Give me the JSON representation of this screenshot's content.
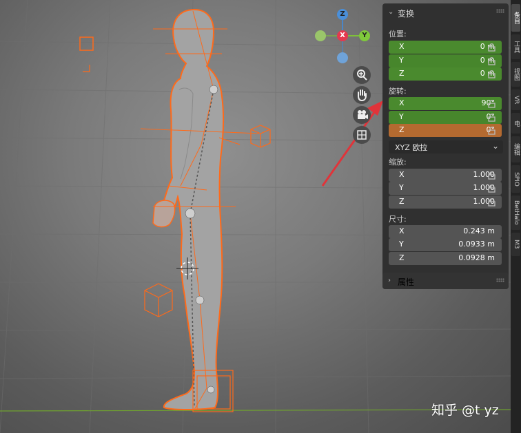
{
  "transform_panel": {
    "title": "变换",
    "location": {
      "label": "位置:",
      "rows": [
        {
          "axis": "X",
          "value": "0 m"
        },
        {
          "axis": "Y",
          "value": "0 m"
        },
        {
          "axis": "Z",
          "value": "0 m"
        }
      ]
    },
    "rotation": {
      "label": "旋转:",
      "rows": [
        {
          "axis": "X",
          "value": "90°"
        },
        {
          "axis": "Y",
          "value": "0°"
        },
        {
          "axis": "Z",
          "value": "0°"
        }
      ],
      "mode": "XYZ 欧拉"
    },
    "scale": {
      "label": "缩放:",
      "rows": [
        {
          "axis": "X",
          "value": "1.000"
        },
        {
          "axis": "Y",
          "value": "1.000"
        },
        {
          "axis": "Z",
          "value": "1.000"
        }
      ]
    },
    "dimensions": {
      "label": "尺寸:",
      "rows": [
        {
          "axis": "X",
          "value": "0.243 m"
        },
        {
          "axis": "Y",
          "value": "0.0933 m"
        },
        {
          "axis": "Z",
          "value": "0.0928 m"
        }
      ]
    }
  },
  "properties_panel": {
    "title": "属性"
  },
  "sidebar_tabs": [
    "条目",
    "工具",
    "视图",
    "VR",
    "电",
    "编辑",
    "SPIO",
    "BetHalo",
    "M3"
  ],
  "gizmo": {
    "z_label": "Z",
    "x_label": "X",
    "y_label": "Y"
  },
  "watermark": "知乎 @t yz",
  "colors": {
    "accent_orange": "#ff6a1a",
    "field_green": "#4a8a2e",
    "field_orange": "#b46a30",
    "arrow_red": "#e0343a"
  },
  "icons": {
    "zoom": "zoom-icon",
    "pan": "hand-icon",
    "camera": "camera-icon",
    "ortho": "grid-icon",
    "lock": "lock-icon"
  }
}
